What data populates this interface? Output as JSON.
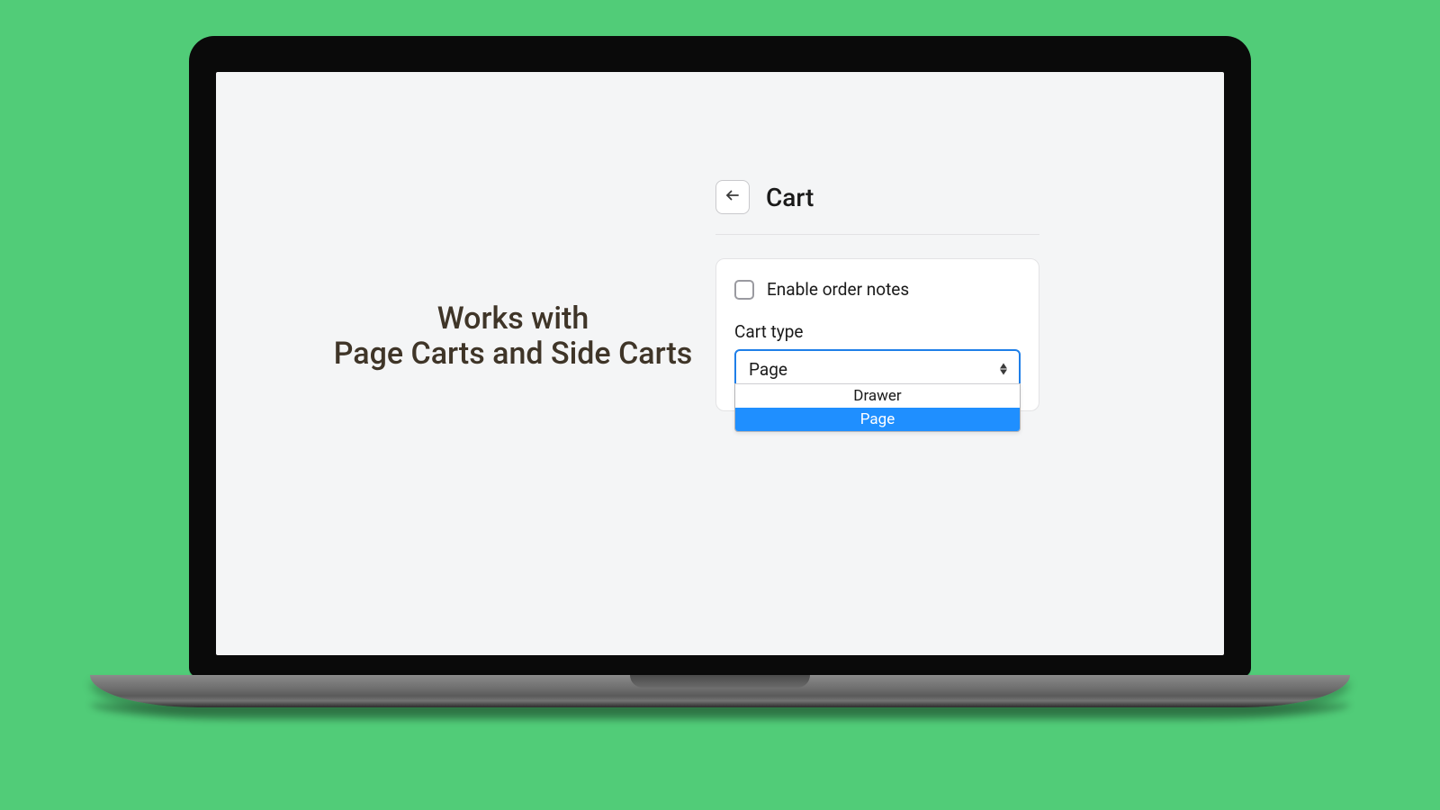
{
  "tagline": {
    "line1": "Works with",
    "line2": "Page Carts and Side Carts"
  },
  "panel": {
    "title": "Cart",
    "checkbox_label": "Enable order notes",
    "cart_type_label": "Cart type",
    "cart_type_value": "Page",
    "options": [
      "Drawer",
      "Page"
    ],
    "selected_option": "Page"
  }
}
